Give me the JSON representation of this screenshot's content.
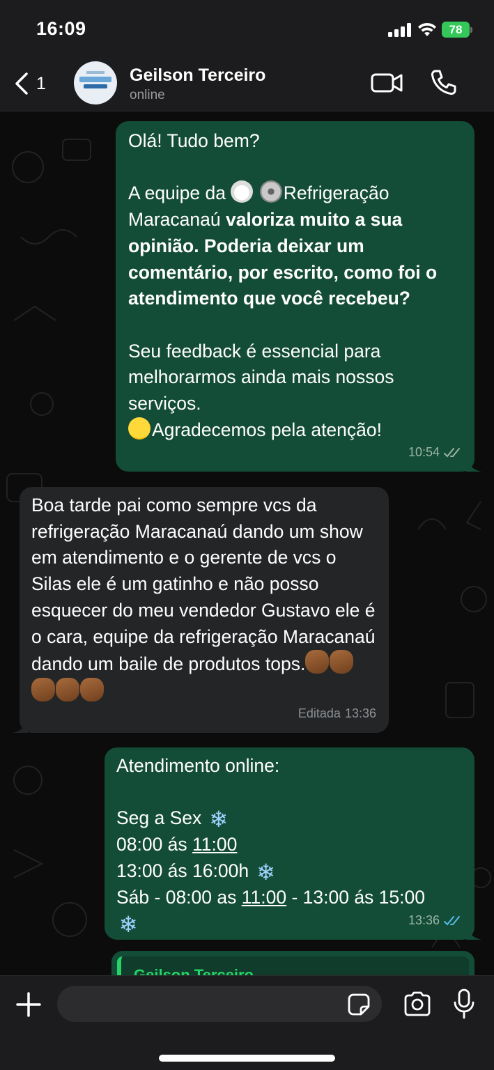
{
  "status_bar": {
    "time": "16:09",
    "battery": "78"
  },
  "header": {
    "back_count": "1",
    "contact_name": "Geilson Terceiro",
    "contact_status": "online"
  },
  "messages": [
    {
      "direction": "outgoing",
      "greeting": "Olá! Tudo bem?",
      "line_team_prefix": "A equipe da ",
      "line_team_brand": "Refrigeração",
      "line_brand_rest": "Maracanaú ",
      "bold_text": "valoriza muito a sua opinião. Poderia deixar um comentário, por escrito, como foi o atendimento que você recebeu?",
      "feedback": "Seu feedback é essencial para melhorarmos ainda mais nossos serviços.",
      "thanks": "Agradecemos pela atenção!",
      "time": "10:54"
    },
    {
      "direction": "incoming",
      "text": "Boa tarde pai como sempre vcs da refrigeração Maracanaú dando um show em atendimento e o gerente de vcs o Silas ele é um gatinho e não posso esquecer do meu vendedor Gustavo ele é o cara, equipe da refrigeração Maracanaú dando um baile de produtos tops.",
      "edited_label": "Editada",
      "time": "13:36"
    },
    {
      "direction": "outgoing",
      "title": "Atendimento online:",
      "days": "Seg a Sex",
      "morning_start": "08:00 ás ",
      "morning_end": "11:00",
      "afternoon": "13:00 ás 16:00h",
      "saturday_start": "Sáb - 08:00 as ",
      "saturday_link": "11:00",
      "saturday_end": " - 13:00 ás 15:00",
      "time": "13:36"
    }
  ],
  "quoted": {
    "author": "Geilson Terceiro"
  },
  "colors": {
    "outgoing_bubble": "#144d37",
    "incoming_bubble": "#232527",
    "read_ticks": "#53bdeb",
    "accent": "#25d366"
  }
}
